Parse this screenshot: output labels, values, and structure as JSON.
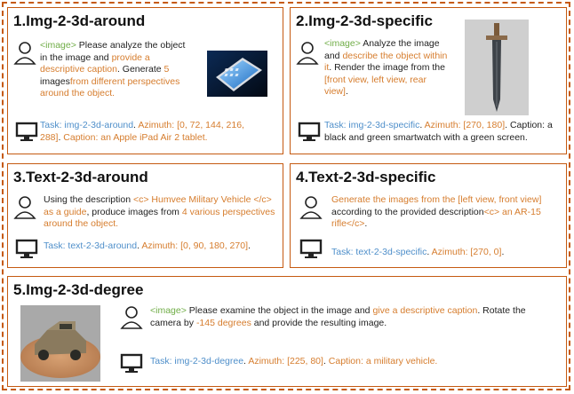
{
  "panels": [
    {
      "title": "1.Img-2-3d-around",
      "prompt": [
        {
          "t": "<image>",
          "c": "g"
        },
        {
          "t": " Please analyze the object in the image and ",
          "c": "k"
        },
        {
          "t": "provide a descriptive caption",
          "c": "o"
        },
        {
          "t": ". Generate ",
          "c": "k"
        },
        {
          "t": "5",
          "c": "o"
        },
        {
          "t": " images",
          "c": "k"
        },
        {
          "t": "from different perspectives around the object.",
          "c": "o"
        }
      ],
      "task": [
        {
          "t": "Task: img-2-3d-around",
          "c": "b"
        },
        {
          "t": ". ",
          "c": "k"
        },
        {
          "t": "Azimuth: [0, 72, 144, 216, 288]",
          "c": "o"
        },
        {
          "t": ". ",
          "c": "k"
        },
        {
          "t": "Caption: an Apple iPad Air 2 tablet.",
          "c": "o"
        }
      ]
    },
    {
      "title": "2.Img-2-3d-specific",
      "prompt": [
        {
          "t": "<image>",
          "c": "g"
        },
        {
          "t": " Analyze the image and ",
          "c": "k"
        },
        {
          "t": "describe the object within it",
          "c": "o"
        },
        {
          "t": ". Render the image from the ",
          "c": "k"
        },
        {
          "t": "[front view, left view, rear view]",
          "c": "o"
        },
        {
          "t": ".",
          "c": "k"
        }
      ],
      "task": [
        {
          "t": "Task: img-2-3d-specific",
          "c": "b"
        },
        {
          "t": ". ",
          "c": "k"
        },
        {
          "t": "Azimuth: [270, 180]",
          "c": "o"
        },
        {
          "t": ". Caption: a black and green smartwatch with a green screen.",
          "c": "k"
        }
      ]
    },
    {
      "title": "3.Text-2-3d-around",
      "prompt": [
        {
          "t": "Using the description ",
          "c": "k"
        },
        {
          "t": "<c> Humvee Military Vehicle </c>",
          "c": "o"
        },
        {
          "t": " as a guide",
          "c": "o"
        },
        {
          "t": ", produce images from ",
          "c": "k"
        },
        {
          "t": "4 various perspectives around the object.",
          "c": "o"
        }
      ],
      "task": [
        {
          "t": "Task: text-2-3d-around",
          "c": "b"
        },
        {
          "t": ". ",
          "c": "k"
        },
        {
          "t": "Azimuth: [0, 90, 180, 270]",
          "c": "o"
        },
        {
          "t": ".",
          "c": "k"
        }
      ]
    },
    {
      "title": "4.Text-2-3d-specific",
      "prompt": [
        {
          "t": "Generate the images from the [left view, front view]",
          "c": "o"
        },
        {
          "t": " according to the provided description",
          "c": "k"
        },
        {
          "t": "<c> an AR-15 rifle</c>",
          "c": "o"
        },
        {
          "t": ".",
          "c": "k"
        }
      ],
      "task": [
        {
          "t": "Task: text-2-3d-specific",
          "c": "b"
        },
        {
          "t": ". ",
          "c": "k"
        },
        {
          "t": "Azimuth: [270, 0]",
          "c": "o"
        },
        {
          "t": ".",
          "c": "k"
        }
      ]
    },
    {
      "title": "5.Img-2-3d-degree",
      "prompt": [
        {
          "t": "<image>",
          "c": "g"
        },
        {
          "t": "  Please examine the object in the image and ",
          "c": "k"
        },
        {
          "t": "give a descriptive caption",
          "c": "o"
        },
        {
          "t": ". Rotate the camera by ",
          "c": "k"
        },
        {
          "t": "-145 degrees",
          "c": "o"
        },
        {
          "t": " and provide the resulting image.",
          "c": "k"
        }
      ],
      "task": [
        {
          "t": "Task: img-2-3d-degree",
          "c": "b"
        },
        {
          "t": ". ",
          "c": "k"
        },
        {
          "t": "Azimuth: [225, 80]",
          "c": "o"
        },
        {
          "t": ". ",
          "c": "k"
        },
        {
          "t": "Caption: a military vehicle.",
          "c": "o"
        }
      ]
    }
  ],
  "icons": {
    "user": "user-icon",
    "monitor": "monitor-icon"
  },
  "colors": {
    "border": "#c55a11",
    "image_tag": "#70ad47",
    "highlight": "#d67d2e",
    "task": "#4f8fca"
  }
}
